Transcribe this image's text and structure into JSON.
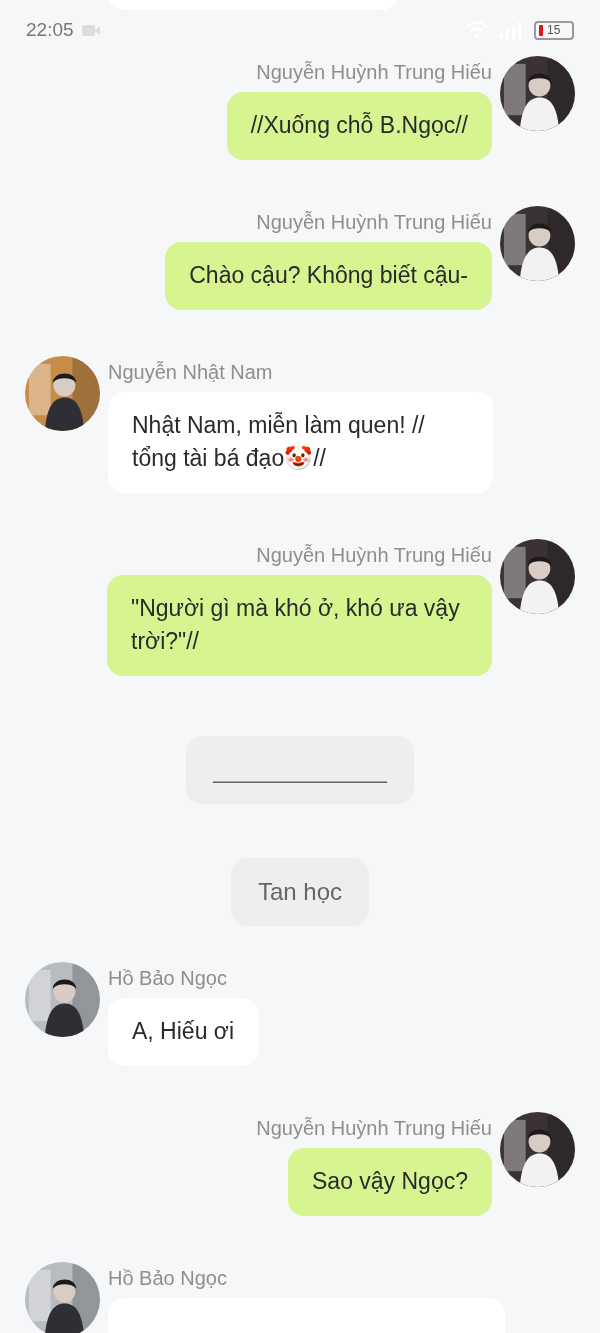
{
  "status_bar": {
    "time": "22:05",
    "battery": "15"
  },
  "messages": [
    {
      "kind": "cut_bubble"
    },
    {
      "kind": "outgoing",
      "sender": "Nguyễn Huỳnh Trung Hiếu",
      "text": "//Xuống chỗ B.Ngọc//"
    },
    {
      "kind": "outgoing",
      "sender": "Nguyễn Huỳnh Trung Hiếu",
      "text": "Chào cậu? Không biết cậu-"
    },
    {
      "kind": "incoming",
      "sender": "Nguyễn Nhật Nam",
      "text": "Nhật Nam, miễn làm quen! // tổng tài bá đạo🤡//"
    },
    {
      "kind": "outgoing",
      "sender": "Nguyễn Huỳnh Trung Hiếu",
      "text": "\"Người gì mà khó ở, khó ưa vậy trời?\"//"
    },
    {
      "kind": "notice",
      "text": "_____________"
    },
    {
      "kind": "notice",
      "text": "Tan học"
    },
    {
      "kind": "incoming",
      "sender": "Hồ Bảo Ngọc",
      "text": "A, Hiếu ơi"
    },
    {
      "kind": "outgoing",
      "sender": "Nguyễn Huỳnh Trung Hiếu",
      "text": "Sao vậy Ngọc?"
    },
    {
      "kind": "incoming",
      "sender": "Hồ Bảo Ngọc"
    }
  ]
}
